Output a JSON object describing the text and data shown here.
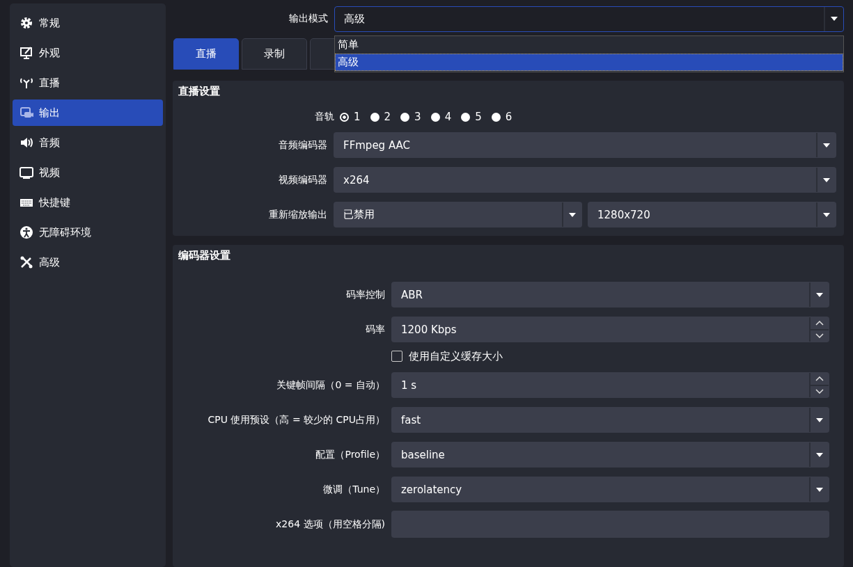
{
  "sidebar": {
    "items": [
      {
        "label": "常规",
        "selected": false
      },
      {
        "label": "外观",
        "selected": false
      },
      {
        "label": "直播",
        "selected": false
      },
      {
        "label": "输出",
        "selected": true
      },
      {
        "label": "音频",
        "selected": false
      },
      {
        "label": "视频",
        "selected": false
      },
      {
        "label": "快捷键",
        "selected": false
      },
      {
        "label": "无障碍环境",
        "selected": false
      },
      {
        "label": "高级",
        "selected": false
      }
    ]
  },
  "output_mode": {
    "label": "输出模式",
    "value": "高级",
    "options": [
      {
        "label": "简单",
        "selected": false
      },
      {
        "label": "高级",
        "selected": true
      }
    ]
  },
  "tabs": [
    {
      "label": "直播",
      "selected": true
    },
    {
      "label": "录制",
      "selected": false
    },
    {
      "selected": false
    }
  ],
  "stream_settings": {
    "title": "直播设置",
    "tracks": {
      "label": "音轨",
      "items": [
        {
          "label": "1",
          "selected": true
        },
        {
          "label": "2",
          "selected": false
        },
        {
          "label": "3",
          "selected": false
        },
        {
          "label": "4",
          "selected": false
        },
        {
          "label": "5",
          "selected": false
        },
        {
          "label": "6",
          "selected": false
        }
      ]
    },
    "rows": [
      {
        "label": "音频编码器",
        "fields": [
          "FFmpeg AAC"
        ]
      },
      {
        "label": "视频编码器",
        "fields": [
          "x264"
        ]
      },
      {
        "label": "重新缩放输出",
        "fields": [
          "已禁用",
          "1280x720"
        ]
      }
    ]
  },
  "encoder_settings": {
    "title": "编码器设置",
    "rows": [
      {
        "kind": "combo",
        "label": "码率控制",
        "value": "ABR"
      },
      {
        "kind": "spin",
        "label": "码率",
        "value": "1200 Kbps"
      },
      {
        "kind": "checkbox",
        "label": "使用自定义缓存大小",
        "checked": false
      },
      {
        "kind": "spin",
        "label": "关键帧间隔（0 = 自动）",
        "value": "1 s"
      },
      {
        "kind": "combo",
        "label": "CPU 使用预设（高 = 较少的 CPU占用）",
        "value": "fast"
      },
      {
        "kind": "combo",
        "label": "配置（Profile）",
        "value": "baseline"
      },
      {
        "kind": "combo",
        "label": "微调（Tune）",
        "value": "zerolatency"
      },
      {
        "kind": "text",
        "label": "x264 选项（用空格分隔)"
      }
    ]
  }
}
